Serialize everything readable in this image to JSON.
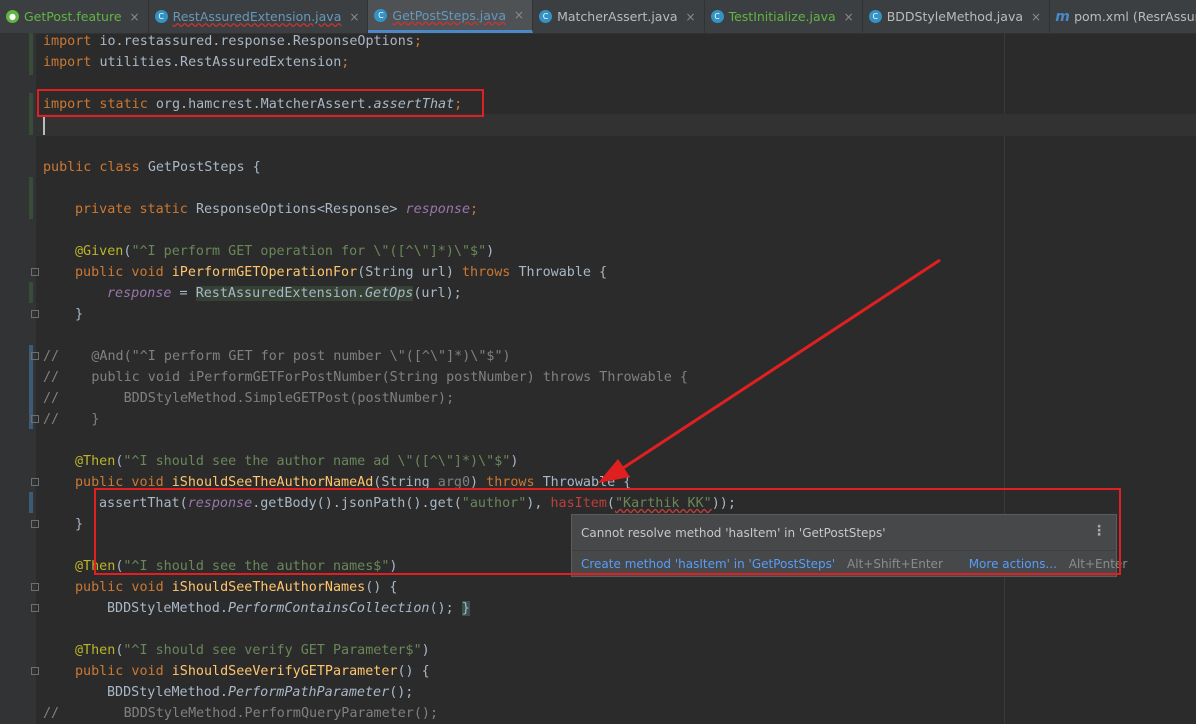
{
  "tabs": [
    {
      "label": "GetPost.feature",
      "icon": "cucumber-icon",
      "color": "green"
    },
    {
      "label": "RestAssuredExtension.java",
      "icon": "class-icon",
      "color": "blue"
    },
    {
      "label": "GetPostSteps.java",
      "icon": "class-icon",
      "color": "blue",
      "active": true
    },
    {
      "label": "MatcherAssert.java",
      "icon": "class-icon",
      "color": "plain"
    },
    {
      "label": "TestInitialize.java",
      "icon": "class-icon",
      "color": "green"
    },
    {
      "label": "BDDStyleMethod.java",
      "icon": "class-icon",
      "color": "plain"
    },
    {
      "label": "pom.xml (ResrAssuredDemo)",
      "icon": "maven-icon",
      "color": "plain"
    }
  ],
  "close_glyph": "×",
  "code": {
    "l1a": "import ",
    "l1b": "io.restassured.response.ResponseOptions",
    "l2a": "import ",
    "l2b": "utilities.RestAssuredExtension",
    "l3a": "import static ",
    "l3b": "org.hamcrest.MatcherAssert.",
    "l3c": "assertThat",
    "l5a": "public class ",
    "l5b": "GetPostSteps {",
    "l6a": "private static ",
    "l6b": "ResponseOptions<Response> ",
    "l6c": "response",
    "l7a": "@Given",
    "l7b": "(",
    "l7c": "\"^I perform GET operation for \\\"([^\\\"]*)\\\"$\"",
    "l7d": ")",
    "l8a": "public void ",
    "l8b": "iPerformGETOperationFor",
    "l8c": "(String url) ",
    "l8d": "throws ",
    "l8e": "Throwable {",
    "l9a": "response",
    "l9b": " = ",
    "l9c": "RestAssuredExtension.",
    "l9d": "GetOps",
    "l9e": "(url);",
    "l10": "}",
    "c1": "//    @And(\"^I perform GET for post number \\\"([^\\\"]*)\\\"$\")",
    "c2": "//    public void iPerformGETForPostNumber(String postNumber) throws Throwable {",
    "c3": "//        BDDStyleMethod.SimpleGETPost(postNumber);",
    "c4": "//    }",
    "l11a": "@Then",
    "l11b": "(",
    "l11c": "\"^I should see the author name ad \\\"([^\\\"]*)\\\"$\"",
    "l11d": ")",
    "l12a": "public void ",
    "l12b": "iShouldSeeTheAuthorNameAd",
    "l12c": "(String ",
    "l12d": "arg0",
    "l12e": ") ",
    "l12f": "throws ",
    "l12g": "Throwable {",
    "l13a": "assertThat(",
    "l13b": "response",
    "l13c": ".getBody().jsonPath().get(",
    "l13d": "\"author\"",
    "l13e": "), ",
    "l13f": "hasItem",
    "l13g": "(",
    "l13h": "\"Karthik KK\"",
    "l13i": "));",
    "l14": "}",
    "l15a": "@Then",
    "l15b": "(",
    "l15c": "\"^I should see the author names$\"",
    "l15d": ")",
    "l16a": "public void ",
    "l16b": "iShouldSeeTheAuthorNames",
    "l16c": "() {",
    "l17a": "BDDStyleMethod.",
    "l17b": "PerformContainsCollection",
    "l17c": "(); ",
    "l17d": "}",
    "l18a": "@Then",
    "l18b": "(",
    "l18c": "\"^I should see verify GET Parameter$\"",
    "l18d": ")",
    "l19a": "public void ",
    "l19b": "iShouldSeeVerifyGETParameter",
    "l19c": "() {",
    "l20a": "BDDStyleMethod.",
    "l20b": "PerformPathParameter",
    "l20c": "();",
    "l21": "//        BDDStyleMethod.PerformQueryParameter();",
    "semi": ";"
  },
  "popup": {
    "message": "Cannot resolve method 'hasItem' in 'GetPostSteps'",
    "menu_glyph": "⋮",
    "create_label": "Create method 'hasItem' in 'GetPostSteps'",
    "create_shortcut": "Alt+Shift+Enter",
    "more_label": "More actions...",
    "more_shortcut": "Alt+Enter"
  },
  "colors": {
    "annotation_red": "#e02020",
    "popup_link": "#589df6",
    "active_tab_underline": "#4a88c7"
  }
}
